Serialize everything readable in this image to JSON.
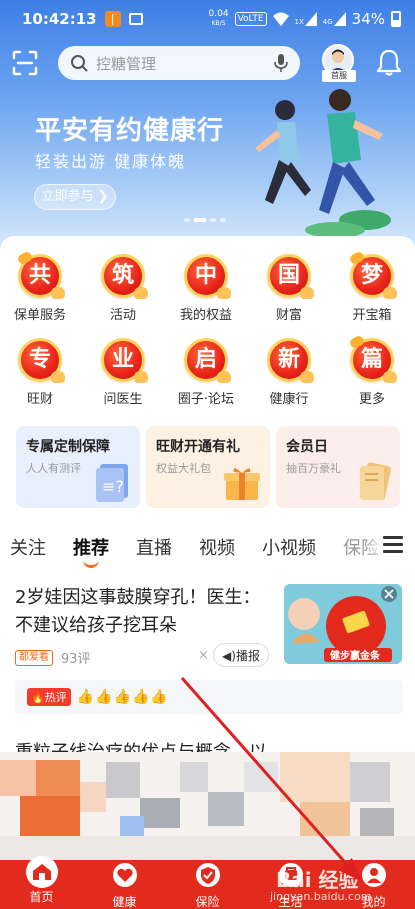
{
  "status_bar": {
    "time": "10:42:13",
    "orange_badge": "|",
    "net_speed_top": "0.04",
    "net_speed_unit": "KB/S",
    "volte": "VoLTE",
    "sig_label_1": "1X",
    "sig_label_2": "4G",
    "battery": "34%"
  },
  "search": {
    "placeholder": "控糖管理"
  },
  "avatar_tag": "首服",
  "hero": {
    "title": "平安有约健康行",
    "subtitle": "轻装出游  健康体魄",
    "cta": "立即参与 ❯"
  },
  "grid": [
    {
      "glyph": "共",
      "label": "保单服务"
    },
    {
      "glyph": "筑",
      "label": "活动"
    },
    {
      "glyph": "中",
      "label": "我的权益"
    },
    {
      "glyph": "国",
      "label": "财富"
    },
    {
      "glyph": "梦",
      "label": "开宝箱"
    },
    {
      "glyph": "专",
      "label": "旺财"
    },
    {
      "glyph": "业",
      "label": "问医生"
    },
    {
      "glyph": "启",
      "label": "圈子·论坛"
    },
    {
      "glyph": "新",
      "label": "健康行"
    },
    {
      "glyph": "篇",
      "label": "更多"
    }
  ],
  "promo_cards": [
    {
      "title": "专属定制保障",
      "sub": "人人有测评"
    },
    {
      "title": "旺财开通有礼",
      "sub": "权益大礼包"
    },
    {
      "title": "会员日",
      "sub": "抽百万豪礼"
    }
  ],
  "feed_tabs": [
    "关注",
    "推荐",
    "直播",
    "视频",
    "小视频",
    "保险"
  ],
  "article": {
    "title": "2岁娃因这事鼓膜穿孔！医生：不建议给孩子挖耳朵",
    "tag": "都爱看",
    "comments": "93评",
    "close": "×",
    "listen": "◀)播报",
    "thumb_caption": "健步赢金条"
  },
  "hot": {
    "badge": "🔥热评",
    "thumbs": "👍👍👍👍👍"
  },
  "next_article_title": "重粒子线治疗的优点与概念，以",
  "bottom_nav": [
    {
      "label": "首页"
    },
    {
      "label": "健康"
    },
    {
      "label": "保险"
    },
    {
      "label": "生活"
    },
    {
      "label": "我的"
    }
  ],
  "watermark": {
    "main": "Bai 经验",
    "sub": "jingyan.baidu.com"
  },
  "colors": {
    "accent": "#e22b1d",
    "tab_underline": "#f26a1b",
    "hero_top": "#3d7fe6"
  }
}
